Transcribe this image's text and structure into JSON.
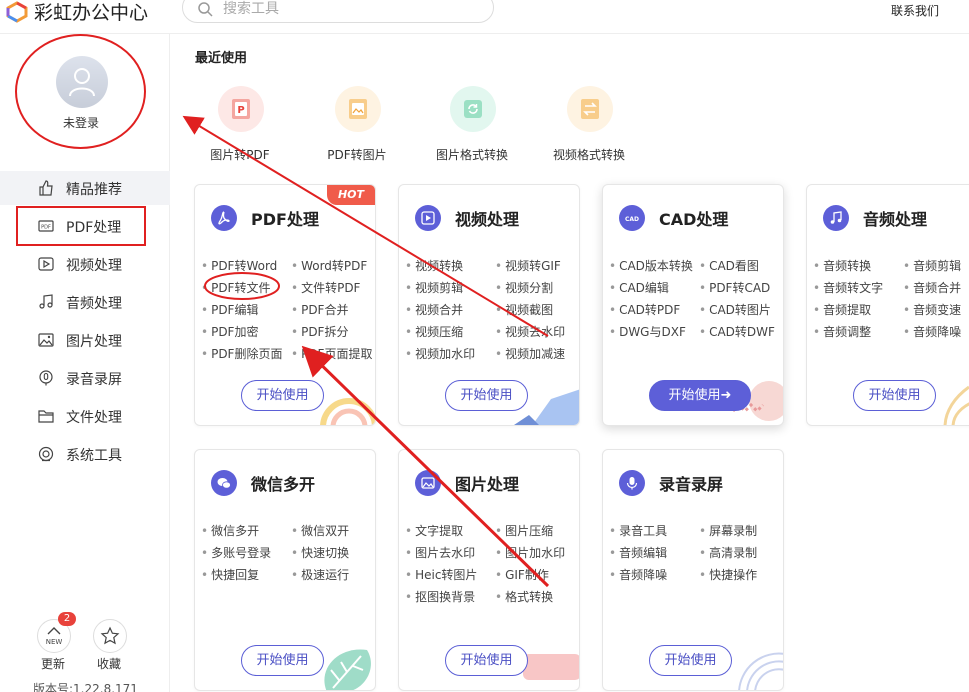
{
  "app": {
    "title": "彩虹办公中心",
    "contact": "联系我们"
  },
  "search": {
    "placeholder": "搜索工具"
  },
  "user": {
    "status": "未登录"
  },
  "sidebar": {
    "items": [
      {
        "label": "精品推荐",
        "icon": "thumbs-up-icon",
        "active": true
      },
      {
        "label": "PDF处理",
        "icon": "pdf-file-icon"
      },
      {
        "label": "视频处理",
        "icon": "video-icon"
      },
      {
        "label": "音频处理",
        "icon": "music-note-icon"
      },
      {
        "label": "图片处理",
        "icon": "image-icon"
      },
      {
        "label": "录音录屏",
        "icon": "microphone-icon"
      },
      {
        "label": "文件处理",
        "icon": "folder-icon"
      },
      {
        "label": "系统工具",
        "icon": "system-tool-icon"
      }
    ],
    "footer": {
      "update_label": "更新",
      "update_badge": "2",
      "favorite_label": "收藏",
      "version": "版本号:1.22.8.171"
    }
  },
  "recent": {
    "title": "最近使用",
    "items": [
      {
        "label": "图片转PDF",
        "color": "#f7c9c5"
      },
      {
        "label": "PDF转图片",
        "color": "#fbe6c8"
      },
      {
        "label": "图片格式转换",
        "color": "#c9f0e0"
      },
      {
        "label": "视频格式转换",
        "color": "#fbe6c8"
      }
    ]
  },
  "cards": [
    {
      "title": "PDF处理",
      "badge": "HOT",
      "features": [
        "PDF转Word",
        "Word转PDF",
        "PDF转文件",
        "文件转PDF",
        "PDF编辑",
        "PDF合并",
        "PDF加密",
        "PDF拆分",
        "PDF删除页面",
        "PDF页面提取"
      ],
      "button": "开始使用"
    },
    {
      "title": "视频处理",
      "features": [
        "视频转换",
        "视频转GIF",
        "视频剪辑",
        "视频分割",
        "视频合并",
        "视频截图",
        "视频压缩",
        "视频去水印",
        "视频加水印",
        "视频加减速"
      ],
      "button": "开始使用"
    },
    {
      "title": "CAD处理",
      "features": [
        "CAD版本转换",
        "CAD看图",
        "CAD编辑",
        "PDF转CAD",
        "CAD转PDF",
        "CAD转图片",
        "DWG与DXF",
        "CAD转DWF"
      ],
      "button": "开始使用"
    },
    {
      "title": "音频处理",
      "features": [
        "音频转换",
        "音频剪辑",
        "音频转文字",
        "音频合并",
        "音频提取",
        "音频变速",
        "音频调整",
        "音频降噪"
      ],
      "button": "开始使用"
    },
    {
      "title": "微信多开",
      "features": [
        "微信多开",
        "微信双开",
        "多账号登录",
        "快速切换",
        "快捷回复",
        "极速运行"
      ],
      "button": "开始使用"
    },
    {
      "title": "图片处理",
      "features": [
        "文字提取",
        "图片压缩",
        "图片去水印",
        "图片加水印",
        "Heic转图片",
        "GIF制作",
        "抠图换背景",
        "格式转换"
      ],
      "button": "开始使用"
    },
    {
      "title": "录音录屏",
      "features": [
        "录音工具",
        "屏幕录制",
        "音频编辑",
        "高清录制",
        "音频降噪",
        "快捷操作"
      ],
      "button": "开始使用"
    }
  ],
  "colors": {
    "accent": "#5d5fd8",
    "annotation": "#e02020",
    "hot": "#f05b4a"
  }
}
